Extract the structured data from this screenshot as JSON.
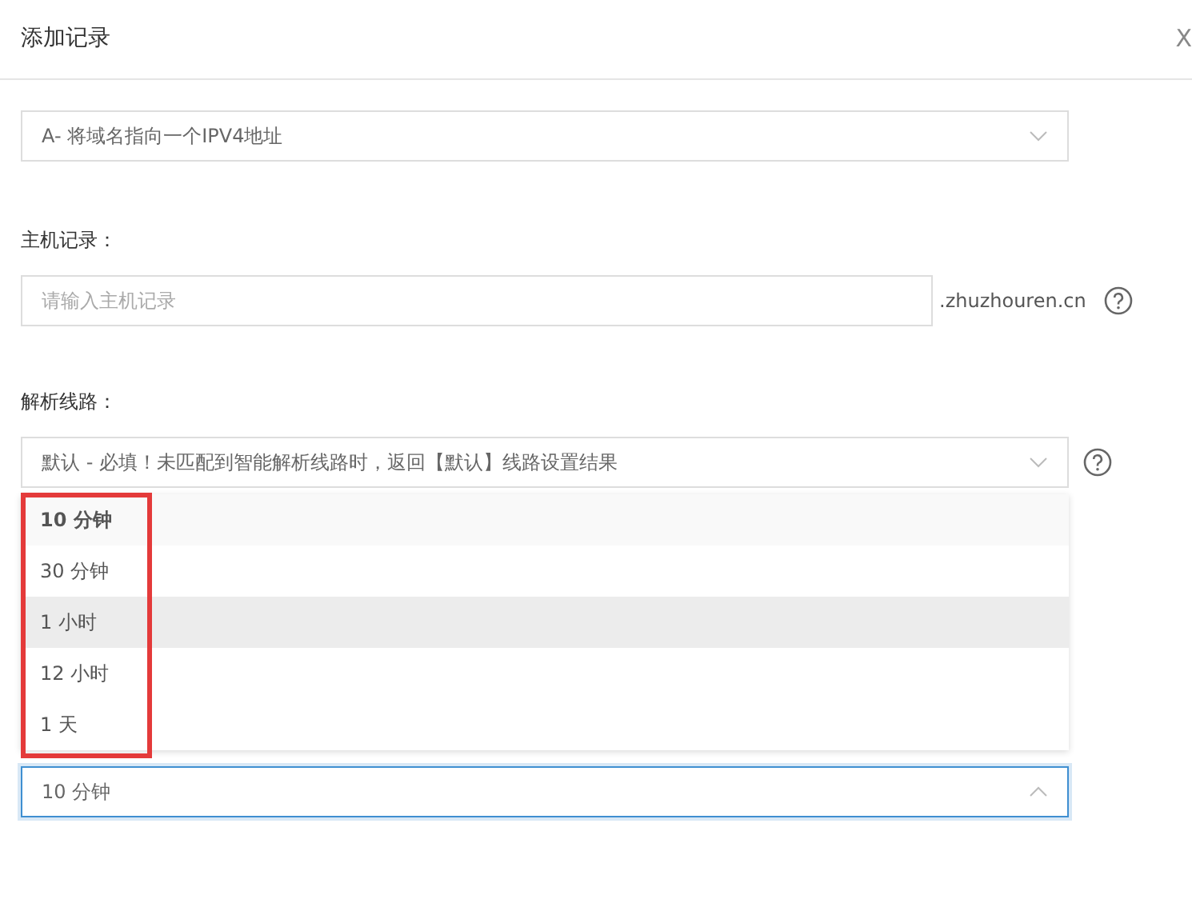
{
  "dialog": {
    "title": "添加记录",
    "close": "X"
  },
  "fields": [
    {
      "kind": "select",
      "value": "A- 将域名指向一个IPV4地址"
    },
    {
      "kind": "input",
      "label": "主机记录：",
      "placeholder": "请输入主机记录",
      "suffix": ".zhuzhouren.cn",
      "help": true
    },
    {
      "kind": "select",
      "label": "解析线路：",
      "value": "默认 - 必填！未匹配到智能解析线路时，返回【默认】线路设置结果",
      "help": true
    },
    {
      "kind": "select",
      "value": "10 分钟",
      "open": true,
      "options": [
        {
          "label": "10 分钟",
          "selected": true,
          "hovered": false
        },
        {
          "label": "30 分钟",
          "selected": false,
          "hovered": false
        },
        {
          "label": "1 小时",
          "selected": false,
          "hovered": true
        },
        {
          "label": "12 小时",
          "selected": false,
          "hovered": false
        },
        {
          "label": "1 天",
          "selected": false,
          "hovered": false
        }
      ]
    }
  ],
  "annotation": {
    "shown": true
  }
}
